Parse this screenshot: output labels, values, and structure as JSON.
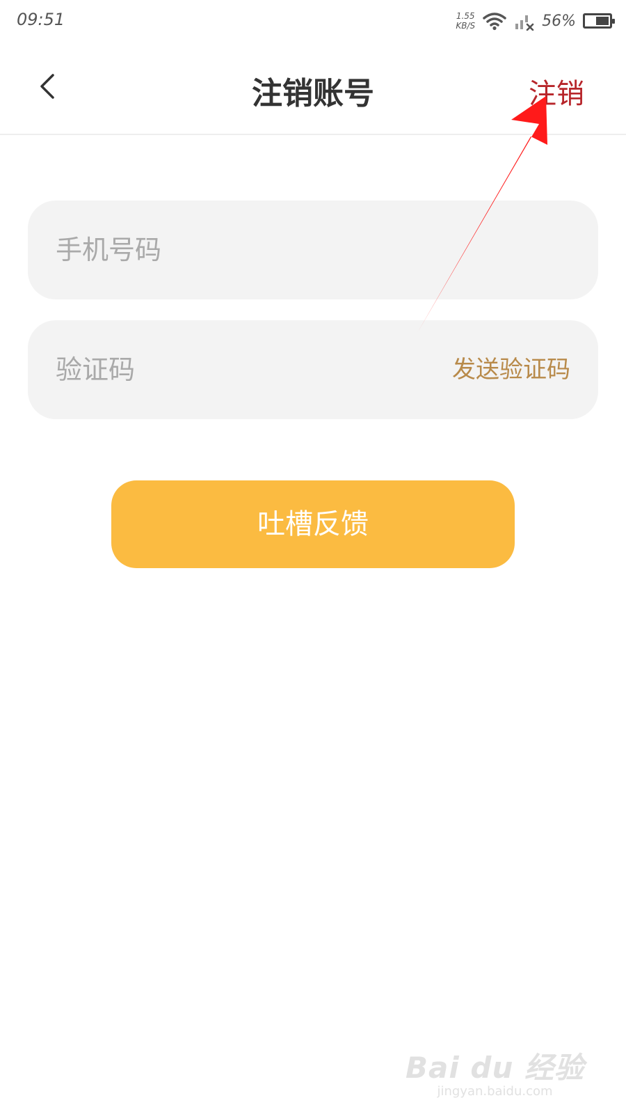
{
  "status_bar": {
    "time": "09:51",
    "net_speed_value": "1.55",
    "net_speed_unit": "KB/S",
    "battery_percent": "56%",
    "battery_level": 0.56
  },
  "nav": {
    "title": "注销账号",
    "action_label": "注销"
  },
  "form": {
    "phone_placeholder": "手机号码",
    "phone_value": "",
    "code_placeholder": "验证码",
    "code_value": "",
    "send_code_label": "发送验证码"
  },
  "feedback_button_label": "吐槽反馈",
  "watermark": {
    "logo_text": "Bai du 经验",
    "url": "jingyan.baidu.com"
  },
  "colors": {
    "accent_red": "#b7252a",
    "button_yellow": "#fbbb41",
    "send_code_gold": "#b88a4a",
    "annotation_arrow": "#ff1a1a"
  }
}
